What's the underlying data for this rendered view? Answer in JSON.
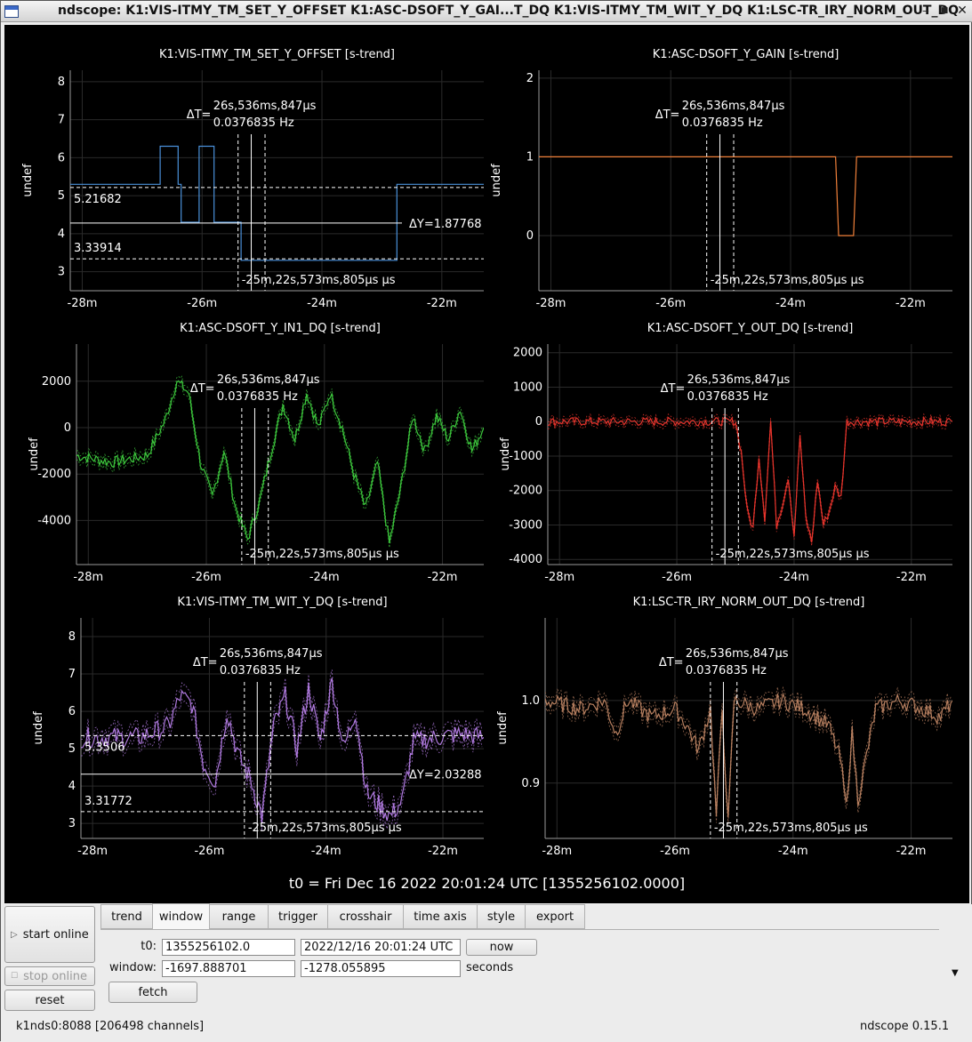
{
  "window": {
    "title": "ndscope: K1:VIS-ITMY_TM_SET_Y_OFFSET K1:ASC-DSOFT_Y_GAI...T_DQ K1:VIS-ITMY_TM_WIT_Y_DQ K1:LSC-TR_IRY_NORM_OUT_DQ",
    "min_icon": "minimize-icon",
    "max_icon": "maximize-icon",
    "close_icon": "close-icon"
  },
  "colors": {
    "plot_bg": "#000000",
    "grid": "#2a2a2a",
    "axis": "#9a9a9a",
    "text": "#ffffff"
  },
  "cursor_labels": {
    "dt": "ΔT=",
    "dt_value": "26s,536ms,847µs",
    "dt_freq": "0.0376835 Hz",
    "t_readout": "-25m,22s,573ms,805µs µs"
  },
  "t0_label": "t0 = Fri Dec 16 2022 20:01:24 UTC [1355256102.0000]",
  "chart_data": [
    {
      "type": "line",
      "title": "K1:VIS-ITMY_TM_SET_Y_OFFSET [s-trend]",
      "ylabel": "undef",
      "xlim": [
        -28.2,
        -21.3
      ],
      "ylim": [
        2.5,
        8.3
      ],
      "xticks": [
        -28,
        -26,
        -24,
        -22
      ],
      "xtick_labels": [
        "-28m",
        "-26m",
        "-24m",
        "-22m"
      ],
      "yticks": [
        3,
        4,
        5,
        6,
        7,
        8
      ],
      "ytick_labels": [
        "3",
        "4",
        "5",
        "6",
        "7",
        "8"
      ],
      "color": "#4a90d9",
      "noise": 0,
      "series": [
        {
          "x": [
            -28.2,
            -26.7,
            -26.7,
            -26.4,
            -26.4,
            -26.35,
            -26.35,
            -26.05,
            -26.05,
            -25.8,
            -25.8,
            -25.6,
            -25.6,
            -25.35,
            -25.35,
            -22.75,
            -22.75,
            -21.3
          ],
          "y": [
            5.3,
            5.3,
            6.3,
            6.3,
            5.3,
            5.3,
            4.3,
            4.3,
            6.3,
            6.3,
            4.3,
            4.3,
            4.3,
            4.3,
            3.3,
            3.3,
            5.3,
            5.3
          ]
        }
      ],
      "cursor_x": [
        -25.4,
        -25.18,
        -24.95
      ],
      "cursor_y": {
        "upper": 5.21682,
        "mid": 4.28,
        "lower": 3.33914,
        "upper_label": "5.21682",
        "lower_label": "3.33914",
        "dy_label": "ΔY=1.87768"
      }
    },
    {
      "type": "line",
      "title": "K1:ASC-DSOFT_Y_GAIN [s-trend]",
      "ylabel": "undef",
      "xlim": [
        -28.2,
        -21.3
      ],
      "ylim": [
        -0.7,
        2.1
      ],
      "xticks": [
        -28,
        -26,
        -24,
        -22
      ],
      "xtick_labels": [
        "-28m",
        "-26m",
        "-24m",
        "-22m"
      ],
      "yticks": [
        0,
        1,
        2
      ],
      "ytick_labels": [
        "0",
        "1",
        "2"
      ],
      "color": "#f0803a",
      "noise": 0,
      "series": [
        {
          "x": [
            -28.2,
            -23.25,
            -23.2,
            -22.95,
            -22.9,
            -21.3
          ],
          "y": [
            1,
            1,
            0,
            0,
            1,
            1
          ]
        }
      ],
      "cursor_x": [
        -25.4,
        -25.18,
        -24.95
      ]
    },
    {
      "type": "line",
      "title": "K1:ASC-DSOFT_Y_IN1_DQ [s-trend]",
      "ylabel": "undef",
      "xlim": [
        -28.2,
        -21.3
      ],
      "ylim": [
        -5900,
        3600
      ],
      "xticks": [
        -28,
        -26,
        -24,
        -22
      ],
      "xtick_labels": [
        "-28m",
        "-26m",
        "-24m",
        "-22m"
      ],
      "yticks": [
        -4000,
        -2000,
        0,
        2000
      ],
      "ytick_labels": [
        "-4000",
        "-2000",
        "0",
        "2000"
      ],
      "color": "#3dc93d",
      "noise": 500,
      "series": [
        {
          "x": [
            -28.2,
            -27.6,
            -27.0,
            -26.7,
            -26.5,
            -26.3,
            -26.1,
            -25.9,
            -25.7,
            -25.5,
            -25.3,
            -25.1,
            -24.9,
            -24.7,
            -24.5,
            -24.3,
            -24.1,
            -23.9,
            -23.7,
            -23.5,
            -23.3,
            -23.1,
            -22.9,
            -22.7,
            -22.5,
            -22.3,
            -22.1,
            -21.9,
            -21.7,
            -21.5,
            -21.3
          ],
          "y": [
            -1200,
            -1500,
            -1200,
            300,
            2000,
            1500,
            -1500,
            -3000,
            -1000,
            -3500,
            -4800,
            -3200,
            -1000,
            1000,
            -500,
            1500,
            0,
            1500,
            0,
            -2000,
            -3500,
            -1500,
            -5000,
            -2500,
            500,
            -1000,
            500,
            -500,
            800,
            -1000,
            0
          ]
        }
      ],
      "cursor_x": [
        -25.4,
        -25.18,
        -24.95
      ]
    },
    {
      "type": "line",
      "title": "K1:ASC-DSOFT_Y_OUT_DQ [s-trend]",
      "ylabel": "undef",
      "xlim": [
        -28.2,
        -21.3
      ],
      "ylim": [
        -4150,
        2250
      ],
      "xticks": [
        -28,
        -26,
        -24,
        -22
      ],
      "xtick_labels": [
        "-28m",
        "-26m",
        "-24m",
        "-22m"
      ],
      "yticks": [
        -4000,
        -3000,
        -2000,
        -1000,
        0,
        1000,
        2000
      ],
      "ytick_labels": [
        "-4000",
        "-3000",
        "-2000",
        "-1000",
        "0",
        "1000",
        "2000"
      ],
      "color": "#e8342c",
      "noise": 250,
      "series": [
        {
          "x": [
            -28.2,
            -25.0,
            -24.9,
            -24.8,
            -24.7,
            -24.6,
            -24.5,
            -24.4,
            -24.3,
            -24.2,
            -24.1,
            -24.0,
            -23.9,
            -23.8,
            -23.7,
            -23.6,
            -23.5,
            -23.4,
            -23.3,
            -23.2,
            -23.1,
            -21.3
          ],
          "y": [
            0,
            0,
            -900,
            -2600,
            -3100,
            -1000,
            -2800,
            0,
            -3000,
            -2400,
            -1600,
            -3300,
            -400,
            -2800,
            -3500,
            -1700,
            -3000,
            -2600,
            -1900,
            -2200,
            0,
            0
          ]
        }
      ],
      "cursor_x": [
        -25.4,
        -25.18,
        -24.95
      ]
    },
    {
      "type": "line",
      "title": "K1:VIS-ITMY_TM_WIT_Y_DQ [s-trend]",
      "ylabel": "undef",
      "xlim": [
        -28.2,
        -21.3
      ],
      "ylim": [
        2.6,
        8.5
      ],
      "xticks": [
        -28,
        -26,
        -24,
        -22
      ],
      "xtick_labels": [
        "-28m",
        "-26m",
        "-24m",
        "-22m"
      ],
      "yticks": [
        3,
        4,
        5,
        6,
        7,
        8
      ],
      "ytick_labels": [
        "3",
        "4",
        "5",
        "6",
        "7",
        "8"
      ],
      "color": "#b07ae0",
      "noise": 0.55,
      "series": [
        {
          "x": [
            -28.2,
            -27.2,
            -26.7,
            -26.5,
            -26.3,
            -26.1,
            -25.9,
            -25.7,
            -25.5,
            -25.3,
            -25.1,
            -24.9,
            -24.7,
            -24.5,
            -24.3,
            -24.1,
            -23.9,
            -23.7,
            -23.5,
            -23.3,
            -23.1,
            -22.9,
            -22.7,
            -22.5,
            -22.1,
            -21.7,
            -21.3
          ],
          "y": [
            5.3,
            5.3,
            5.6,
            6.4,
            6.2,
            4.6,
            4.1,
            6.0,
            4.8,
            4.2,
            3.2,
            5.6,
            6.4,
            5.0,
            6.6,
            5.2,
            6.8,
            5.0,
            6.0,
            3.8,
            3.5,
            3.2,
            3.6,
            5.2,
            5.3,
            5.4,
            5.3
          ]
        }
      ],
      "cursor_x": [
        -25.4,
        -25.18,
        -24.95
      ],
      "cursor_y": {
        "upper": 5.3506,
        "mid": 4.32,
        "lower": 3.31772,
        "upper_label": "5.3506",
        "lower_label": "3.31772",
        "dy_label": "ΔY=2.03288"
      }
    },
    {
      "type": "line",
      "title": "K1:LSC-TR_IRY_NORM_OUT_DQ [s-trend]",
      "ylabel": "undef",
      "xlim": [
        -28.2,
        -21.3
      ],
      "ylim": [
        0.833,
        1.1
      ],
      "xticks": [
        -28,
        -26,
        -24,
        -22
      ],
      "xtick_labels": [
        "-28m",
        "-26m",
        "-24m",
        "-22m"
      ],
      "yticks": [
        0.9,
        1.0
      ],
      "ytick_labels": [
        "0.9",
        "1.0"
      ],
      "color": "#b88060",
      "noise": 0.02,
      "series": [
        {
          "x": [
            -28.2,
            -27.6,
            -27.2,
            -27.0,
            -26.8,
            -26.4,
            -26.0,
            -25.8,
            -25.6,
            -25.4,
            -25.3,
            -25.2,
            -25.1,
            -25.0,
            -24.6,
            -24.2,
            -23.8,
            -23.4,
            -23.2,
            -23.1,
            -23.0,
            -22.9,
            -22.6,
            -22.2,
            -21.8,
            -21.5,
            -21.3
          ],
          "y": [
            1.0,
            0.99,
            1.0,
            0.96,
            1.0,
            0.98,
            0.99,
            0.97,
            0.94,
            0.99,
            0.86,
            0.99,
            0.85,
            1.0,
            0.99,
            1.0,
            0.99,
            0.97,
            0.93,
            0.87,
            0.96,
            0.88,
            0.99,
            1.0,
            0.99,
            0.98,
            1.0
          ]
        }
      ],
      "cursor_x": [
        -25.4,
        -25.18,
        -24.95
      ]
    }
  ],
  "controls": {
    "start_online": "start online",
    "stop_online": "stop online",
    "reset": "reset",
    "tabs": [
      "trend",
      "window",
      "range",
      "trigger",
      "crosshair",
      "time axis",
      "style",
      "export"
    ],
    "active_tab": "window",
    "t0_label": "t0:",
    "t0_gps": "1355256102.0",
    "t0_utc": "2022/12/16 20:01:24 UTC",
    "now": "now",
    "window_label": "window:",
    "window_start": "-1697.888701",
    "window_end": "-1278.055895",
    "seconds": "seconds",
    "fetch": "fetch"
  },
  "status": {
    "server": "k1nds0:8088  [206498 channels]",
    "version": "ndscope 0.15.1"
  }
}
